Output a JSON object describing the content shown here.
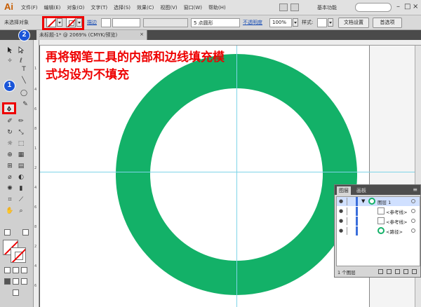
{
  "app": {
    "logo": "Ai"
  },
  "menubar": {
    "items": [
      "文件(F)",
      "编辑(E)",
      "对象(O)",
      "文字(T)",
      "选择(S)",
      "效果(C)",
      "视图(V)",
      "窗口(W)",
      "帮助(H)"
    ],
    "workspace": "基本功能",
    "window_controls": [
      "–",
      "□",
      "×"
    ]
  },
  "controlbar": {
    "no_selection": "未选择对象",
    "stroke_label": "描边",
    "profile_value": "5 点圆形",
    "opacity_label": "不透明度",
    "opacity_value": "100%",
    "style_label": "样式:",
    "doc_setup": "文档设置",
    "preferences": "首选项"
  },
  "tab": {
    "title": "未标题-1* @ 2069% (CMYK/预览)",
    "close": "×"
  },
  "annotation": {
    "text": "再将钢笔工具的内部和边线填充模式均设为不填充"
  },
  "badges": {
    "one": "1",
    "two": "2"
  },
  "ruler": {
    "marks": [
      "1",
      "4",
      "6",
      "8",
      "1",
      "2",
      "4",
      "6",
      "8",
      "2",
      "4",
      "6"
    ]
  },
  "layers_panel": {
    "tabs": [
      "图层",
      "画板"
    ],
    "menu": "≡",
    "rows": [
      {
        "name": "图层 1"
      },
      {
        "name": "<参考线>"
      },
      {
        "name": "<参考线>"
      },
      {
        "name": "<路径>"
      }
    ],
    "footer": "1 个图层"
  },
  "colors": {
    "ring": "#13b168",
    "highlight": "#e00000",
    "badge": "#1a55d8"
  }
}
